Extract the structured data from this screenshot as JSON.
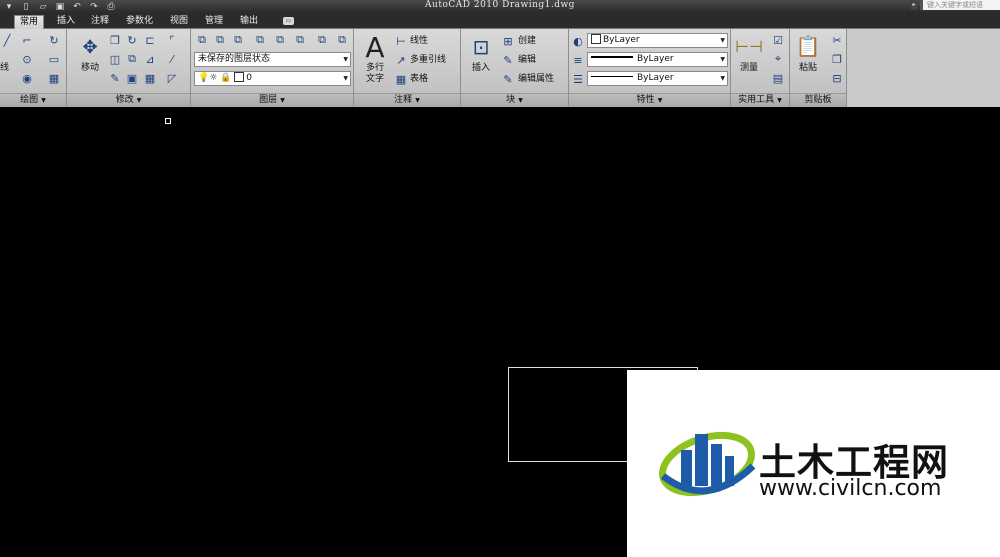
{
  "window": {
    "title": "AutoCAD 2010  Drawing1.dwg",
    "search_placeholder": "键入关键字或短语"
  },
  "tabs": [
    {
      "label": "常用",
      "active": true
    },
    {
      "label": "插入"
    },
    {
      "label": "注释"
    },
    {
      "label": "参数化"
    },
    {
      "label": "视图"
    },
    {
      "label": "管理"
    },
    {
      "label": "输出"
    }
  ],
  "panels": {
    "draw": {
      "title": "绘图",
      "line_label": "线"
    },
    "modify": {
      "title": "修改",
      "move_label": "移动"
    },
    "layers": {
      "title": "图层",
      "layer_state": "未保存的图层状态",
      "current_layer": "0"
    },
    "annotation": {
      "title": "注释",
      "mtext_label_1": "多行",
      "mtext_label_2": "文字",
      "linear": "线性",
      "mleader": "多重引线",
      "table": "表格"
    },
    "block": {
      "title": "块",
      "insert": "插入",
      "create": "创建",
      "edit": "编辑",
      "edit_attr": "编辑属性"
    },
    "properties": {
      "title": "特性",
      "color": "ByLayer",
      "lineweight": "ByLayer",
      "linetype": "ByLayer"
    },
    "utilities": {
      "title": "实用工具",
      "measure": "测量"
    },
    "clipboard": {
      "title": "剪贴板",
      "paste": "粘贴"
    }
  },
  "watermark": {
    "title": "土木工程网",
    "url": "www.civilcn.com"
  },
  "colors": {
    "canvas_bg": "#000000",
    "logo_green": "#8dc21f",
    "logo_blue": "#1e5ba8"
  }
}
